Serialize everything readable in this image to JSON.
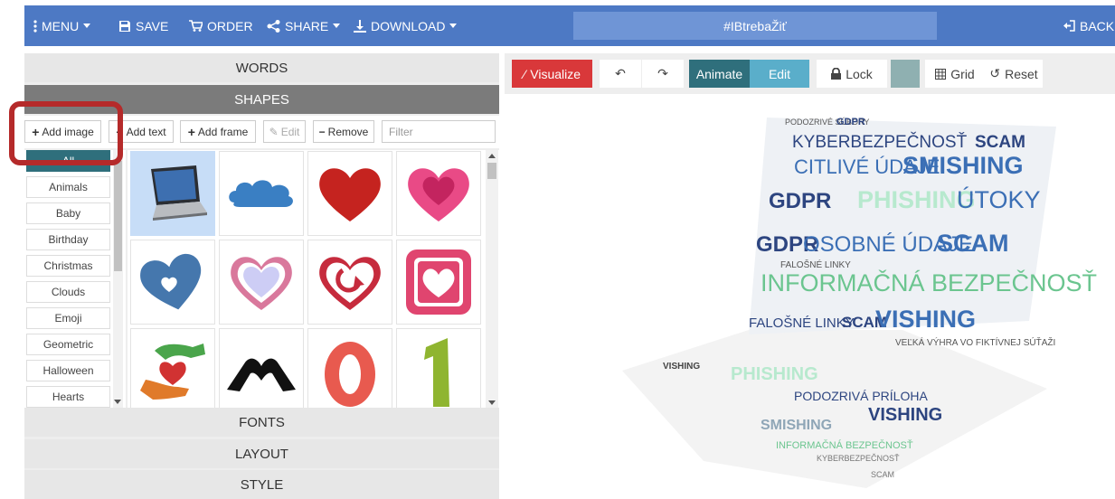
{
  "topbar": {
    "menu_label": "MENU",
    "save_label": "SAVE",
    "order_label": "ORDER",
    "share_label": "SHARE",
    "download_label": "DOWNLOAD",
    "title": "#IBtrebaŽiť",
    "back_label": "BACK"
  },
  "left_panel": {
    "sections": {
      "words": "WORDS",
      "shapes": "SHAPES",
      "fonts": "FONTS",
      "layout": "LAYOUT",
      "style": "STYLE"
    },
    "toolbar": {
      "add_image": "Add image",
      "add_text": "Add text",
      "add_frame": "Add frame",
      "edit": "Edit",
      "remove": "Remove",
      "filter_placeholder": "Filter"
    },
    "categories": [
      "All",
      "Animals",
      "Baby",
      "Birthday",
      "Christmas",
      "Clouds",
      "Emoji",
      "Geometric",
      "Halloween",
      "Hearts"
    ],
    "shapes": [
      "laptop",
      "cloud",
      "heart-red",
      "heart-pink-double",
      "heart-blue",
      "heart-outline-pink",
      "heart-arrow-red",
      "heart-square-pink",
      "hands-heart",
      "hands-heart-black",
      "number-zero",
      "number-one"
    ]
  },
  "right_panel": {
    "visualize_label": "Visualize",
    "animate_label": "Animate",
    "edit_label": "Edit",
    "lock_label": "Lock",
    "grid_label": "Grid",
    "reset_label": "Reset",
    "colors": {
      "visualize": "#d9383a",
      "animate": "#2f6f7c",
      "edit": "#5aaeca",
      "swatch": "#8fb0b1"
    }
  },
  "word_cloud": {
    "words": [
      "PODOZRIVÉ SÚBORY",
      "GDPR",
      "KYBERBEZPEČNOSŤ",
      "SCAM",
      "ÚTOKY",
      "CITLIVÉ ÚDAJE",
      "SMISHING",
      "PHISHING",
      "OSOBNÉ ÚDAJE",
      "FALOŠNÉ LINKY",
      "INFORMAČNÁ BEZPEČNOSŤ",
      "VISHING",
      "VEĽKÁ VÝHRA VO FIKTÍVNEJ SÚŤAŽI",
      "PODOZRIVÁ PRÍLOHA"
    ]
  }
}
